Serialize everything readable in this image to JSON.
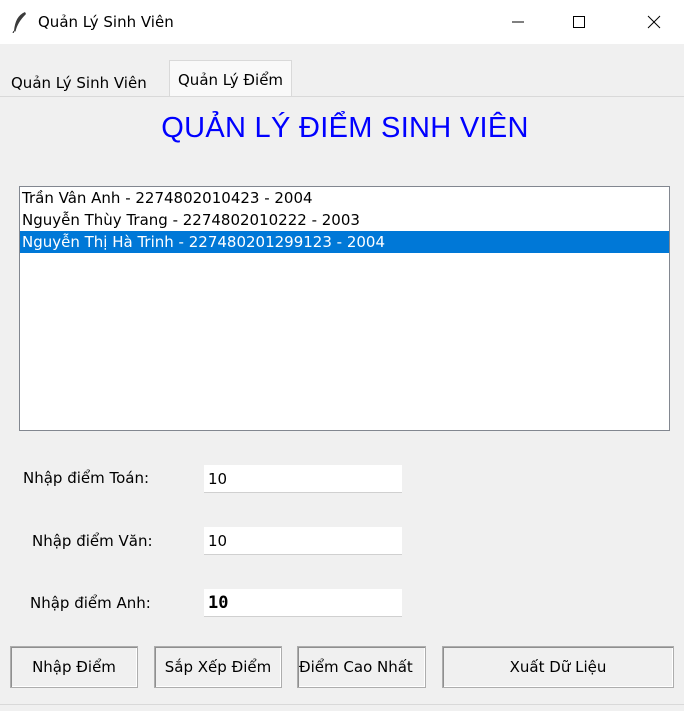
{
  "window": {
    "title": "Quản Lý Sinh Viên",
    "icon": "feather-icon"
  },
  "tabs": [
    {
      "label": "Quản Lý Sinh Viên",
      "active": false
    },
    {
      "label": "Quản Lý Điểm",
      "active": true
    }
  ],
  "heading": "QUẢN LÝ ĐIỂM SINH VIÊN",
  "students": [
    {
      "text": "Trần Vân Anh - 2274802010423 - 2004",
      "selected": false
    },
    {
      "text": "Nguyễn Thùy Trang - 2274802010222 - 2003",
      "selected": false
    },
    {
      "text": "Nguyễn Thị Hà Trinh - 227480201299123 - 2004",
      "selected": true
    }
  ],
  "form": {
    "math_label": "Nhập điểm Toán:",
    "math_value": "10",
    "literature_label": "Nhập điểm Văn:",
    "literature_value": "10",
    "english_label": "Nhập điểm Anh:",
    "english_value": "10"
  },
  "buttons": {
    "enter_scores": "Nhập Điểm",
    "sort_scores": "Sắp Xếp Điểm",
    "highest_score": "Điểm Cao Nhất",
    "export_data": "Xuất Dữ Liệu"
  },
  "colors": {
    "heading": "#0000ff",
    "selection": "#0078d7"
  }
}
